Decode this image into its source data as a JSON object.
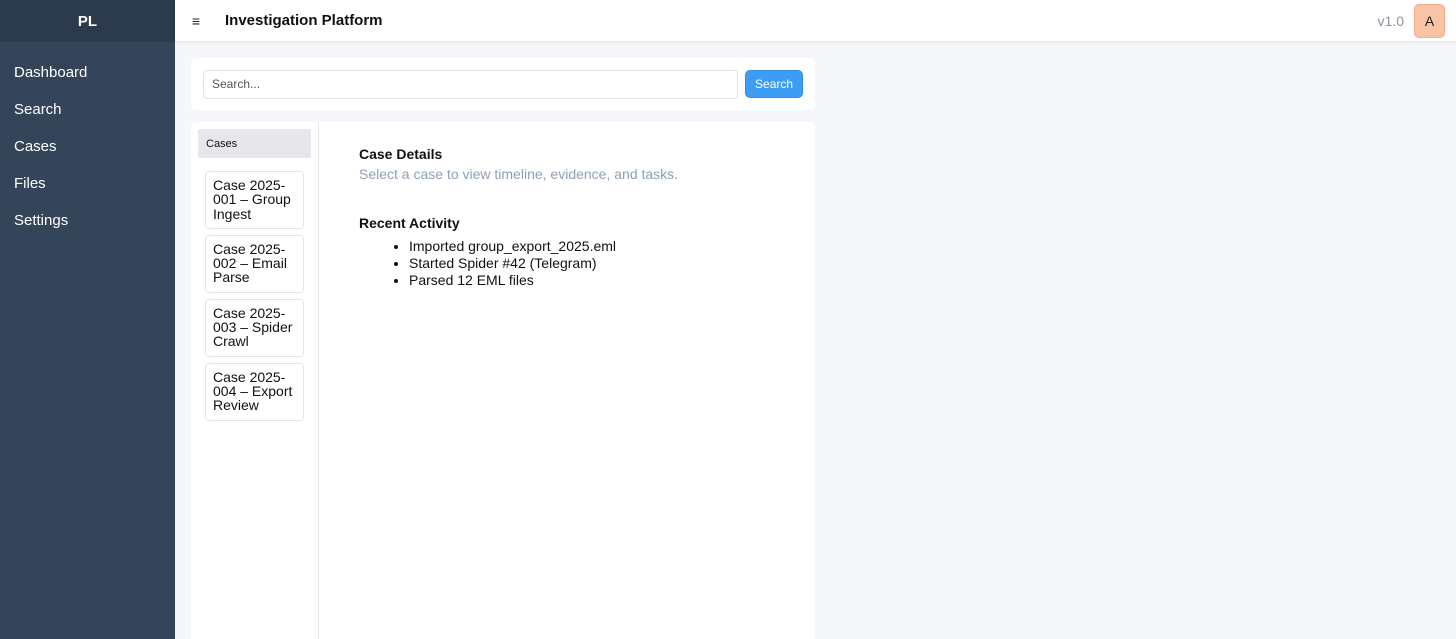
{
  "sidebar": {
    "brand": "PL",
    "items": [
      {
        "label": "Dashboard"
      },
      {
        "label": "Search"
      },
      {
        "label": "Cases"
      },
      {
        "label": "Files"
      },
      {
        "label": "Settings"
      }
    ]
  },
  "topbar": {
    "menu_icon": "hamburger-menu-icon",
    "menu_glyph": "≡",
    "title": "Investigation Platform",
    "version": "v1.0",
    "avatar_initial": "A",
    "avatar_color": "#f9c4a6"
  },
  "search": {
    "placeholder": "Search...",
    "value": "",
    "button_label": "Search",
    "button_color": "#3b9ef4"
  },
  "cases": {
    "header": "Cases",
    "items": [
      {
        "label": "Case 2025-001 – Group Ingest"
      },
      {
        "label": "Case 2025-002 – Email Parse"
      },
      {
        "label": "Case 2025-003 – Spider Crawl"
      },
      {
        "label": "Case 2025-004 – Export Review"
      }
    ]
  },
  "details": {
    "title": "Case Details",
    "subtitle": "Select a case to view timeline, evidence, and tasks.",
    "activity_title": "Recent Activity",
    "activity": [
      {
        "text": "Imported group_export_2025.eml"
      },
      {
        "text": "Started Spider #42 (Telegram)"
      },
      {
        "text": "Parsed 12 EML files"
      }
    ]
  },
  "colors": {
    "sidebar_bg": "#34455a",
    "brand_bg": "#2b3a4c",
    "page_bg": "#f5f7fa",
    "subtitle_text": "#8ea0b6"
  }
}
